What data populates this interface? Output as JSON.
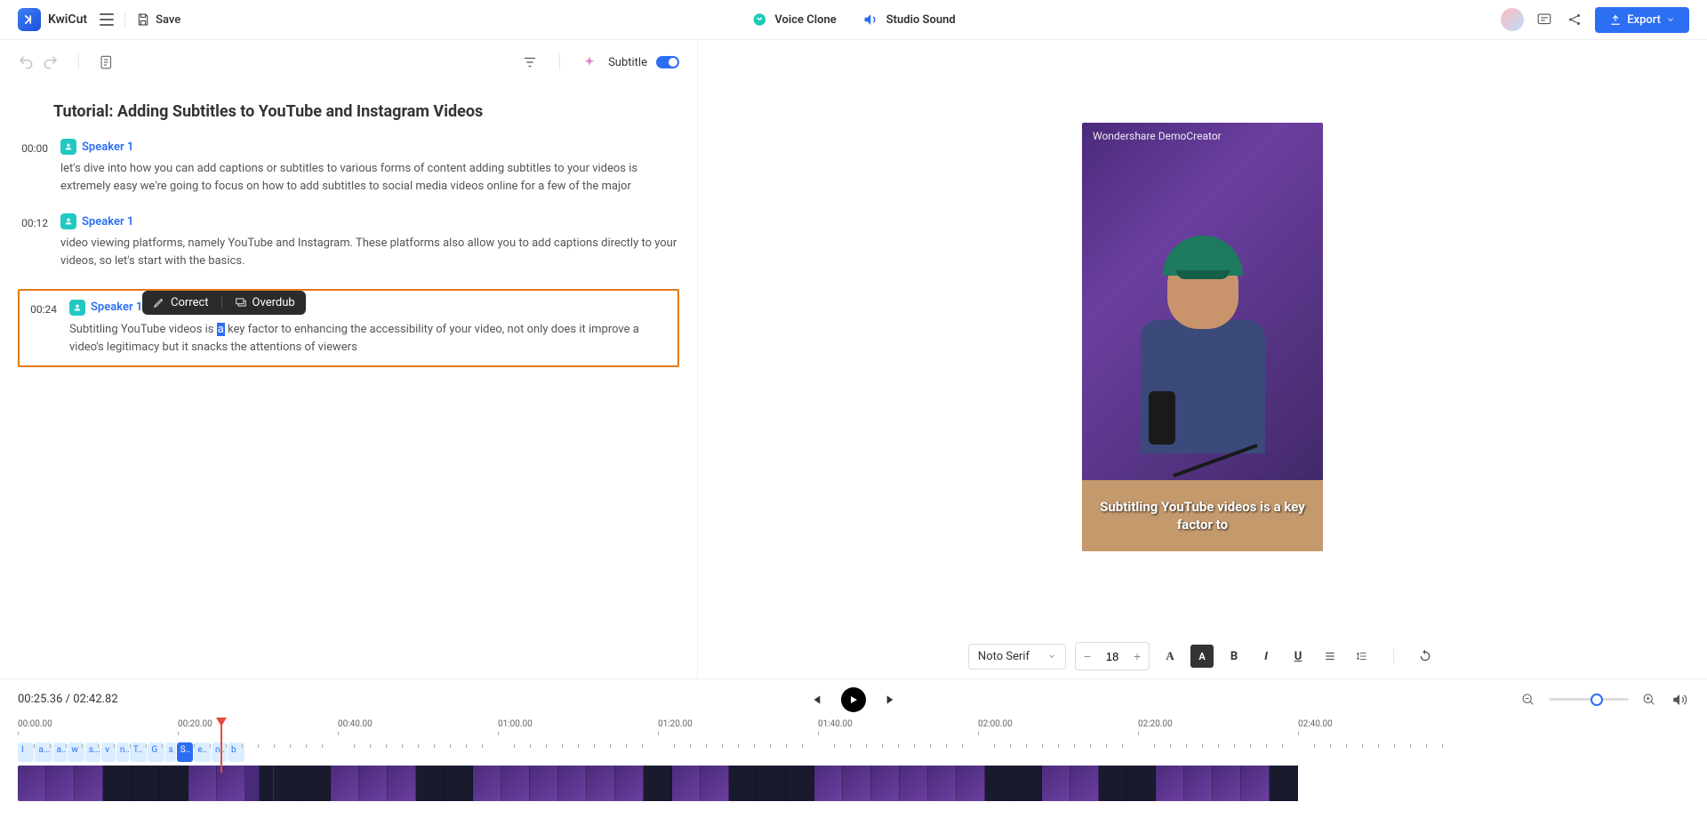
{
  "app": {
    "brand": "KwiCut",
    "save": "Save"
  },
  "features": {
    "voice_clone": "Voice Clone",
    "studio_sound": "Studio Sound"
  },
  "export": {
    "label": "Export"
  },
  "editor": {
    "subtitle_label": "Subtitle"
  },
  "document": {
    "title": "Tutorial: Adding Subtitles to YouTube and Instagram Videos",
    "blocks": [
      {
        "time": "00:00",
        "speaker": "Speaker 1",
        "text": "let's dive into how you can add captions or subtitles to various forms of content adding subtitles to your videos is extremely easy we're going to focus on how to add subtitles to social media videos online for a few of the major"
      },
      {
        "time": "00:12",
        "speaker": "Speaker 1",
        "text": "video viewing platforms, namely YouTube and Instagram. These platforms also allow you to add captions directly to your videos, so let's start with the basics."
      },
      {
        "time": "00:24",
        "speaker": "Speaker 1",
        "text_pre": "Subtitling YouTube videos is ",
        "text_hi": "a",
        "text_post": " key factor to enhancing the accessibility of your video, not only does it improve a video's legitimacy but it snacks the attentions of viewers"
      }
    ]
  },
  "context_menu": {
    "correct": "Correct",
    "overdub": "Overdub"
  },
  "preview": {
    "watermark": "Wondershare DemoCreator",
    "caption": "Subtitling YouTube videos is a key factor to"
  },
  "text_toolbar": {
    "font": "Noto Serif",
    "size": "18"
  },
  "playback": {
    "current": "00:25.36",
    "sep": " / ",
    "total": "02:42.82"
  },
  "ruler": [
    "00:00.00",
    "00:20.00",
    "00:40.00",
    "01:00.00",
    "01:20.00",
    "01:40.00",
    "02:00.00",
    "02:20.00",
    "02:40.00"
  ],
  "word_chips": [
    "I",
    "a...",
    "a...",
    "w",
    "s...",
    "v",
    "n..",
    "T..",
    "G",
    "s",
    "S..",
    "e..",
    "n..",
    "b"
  ]
}
